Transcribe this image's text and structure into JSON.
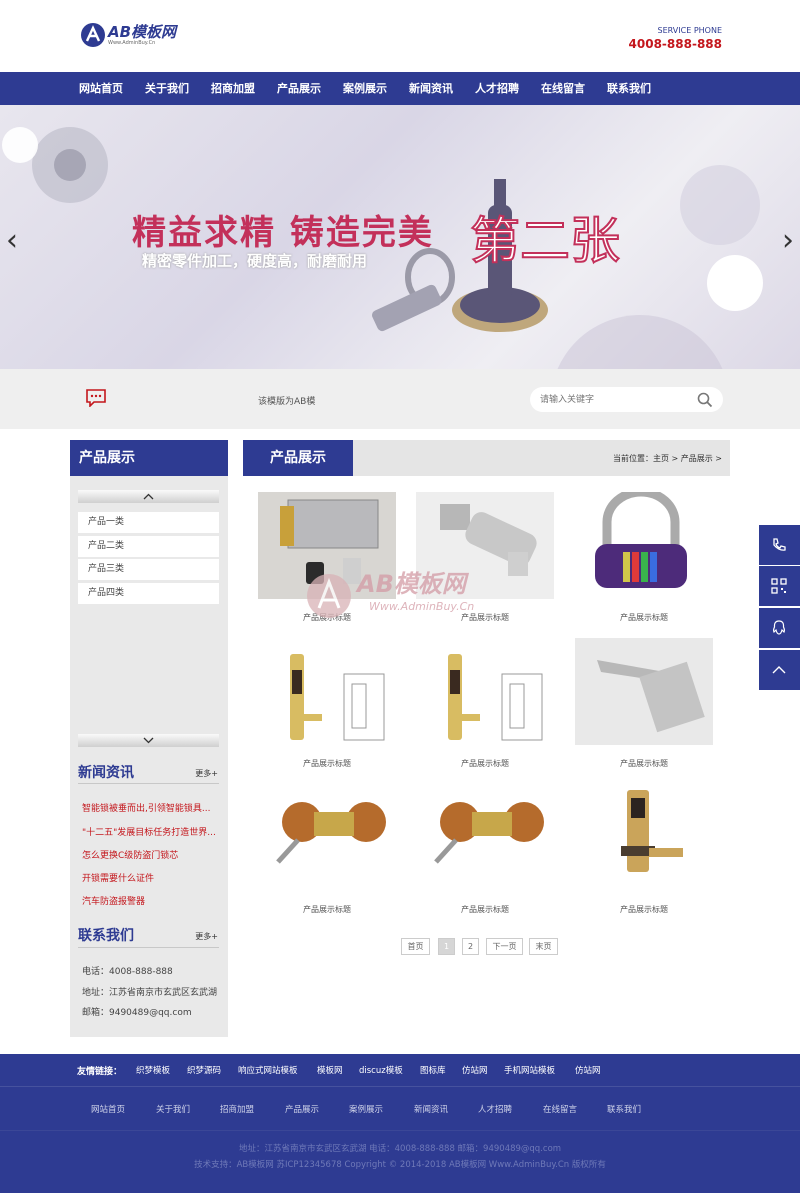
{
  "header": {
    "logo_text": "AB模板网",
    "logo_sub": "Www.AdminBuy.Cn",
    "phone_label": "SERVICE PHONE",
    "phone": "4008-888-888"
  },
  "nav": [
    "网站首页",
    "关于我们",
    "招商加盟",
    "产品展示",
    "案例展示",
    "新闻资讯",
    "人才招聘",
    "在线留言",
    "联系我们"
  ],
  "banner": {
    "slogan": "精益求精 铸造完美",
    "subline": "精密零件加工，硬度高，耐磨耐用",
    "overlay": "第二张",
    "prev_arrow": "‹",
    "next_arrow": "›"
  },
  "search": {
    "notice": "该模版为AB模",
    "placeholder": "请输入关键字",
    "icon": "search-icon"
  },
  "sidebar": {
    "title": "产品展示",
    "categories": [
      "产品一类",
      "产品二类",
      "产品三类",
      "产品四类"
    ],
    "news_title": "新闻资讯",
    "news_more": "更多+",
    "news": [
      "智能锁被垂而出,引领智能锁具...",
      "\"十二五\"发展目标任务打造世界...",
      "怎么更换C级防盗门锁芯",
      "开锁需要什么证件",
      "汽车防盗报警器"
    ],
    "contact_title": "联系我们",
    "contact_more": "更多+",
    "contact": [
      "电话：4008-888-888",
      "地址：江苏省南京市玄武区玄武湖",
      "邮箱：9490489@qq.com"
    ]
  },
  "main": {
    "title": "产品展示",
    "breadcrumb": "当前位置：主页 > 产品展示 >",
    "products": [
      "产品展示标题",
      "产品展示标题",
      "产品展示标题",
      "产品展示标题",
      "产品展示标题",
      "产品展示标题",
      "产品展示标题",
      "产品展示标题",
      "产品展示标题"
    ]
  },
  "pager": {
    "first": "首页",
    "p1": "1",
    "p2": "2",
    "next": "下一页",
    "last": "末页"
  },
  "watermark": {
    "text": "AB模板网",
    "url": "Www.AdminBuy.Cn"
  },
  "float_icons": [
    "phone-icon",
    "qrcode-icon",
    "qq-icon",
    "back-to-top-icon"
  ],
  "footer": {
    "links_label": "友情链接：",
    "links": [
      "织梦模板",
      "织梦源码",
      "响应式网站模板",
      "模板网",
      "discuz模板",
      "图标库",
      "仿站网",
      "手机网站模板",
      "仿站网"
    ],
    "nav": [
      "网站首页",
      "关于我们",
      "招商加盟",
      "产品展示",
      "案例展示",
      "新闻资讯",
      "人才招聘",
      "在线留言",
      "联系我们"
    ],
    "line1": "地址：江苏省南京市玄武区玄武湖    电话：4008-888-888    邮箱：9490489@qq.com",
    "line2": "技术支持：AB模板网    苏ICP12345678    Copyright © 2014-2018 AB模板网 Www.AdminBuy.Cn 版权所有"
  },
  "colors": {
    "primary": "#2e3b92",
    "accent": "#c4161c",
    "banner_text": "#c3305a"
  }
}
